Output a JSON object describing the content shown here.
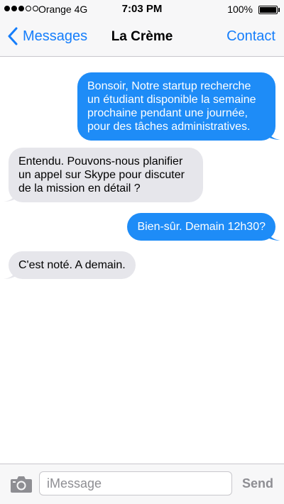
{
  "status_bar": {
    "carrier": "Orange 4G",
    "time": "7:03 PM",
    "battery": "100%",
    "signal_strength": 3,
    "signal_max": 5
  },
  "nav": {
    "back_label": "Messages",
    "title": "La Crème",
    "contact_label": "Contact"
  },
  "messages": [
    {
      "direction": "outgoing",
      "text": "Bonsoir, Notre startup recherche\nun étudiant disponible la semaine\nprochaine pendant une journée,\npour des tâches administratives."
    },
    {
      "direction": "incoming",
      "text": "Entendu. Pouvons-nous planifier\nun appel sur Skype pour discuter\nde la mission en détail ?"
    },
    {
      "direction": "outgoing",
      "text": "Bien-sûr. Demain 12h30?"
    },
    {
      "direction": "incoming",
      "text": "C'est noté. A demain."
    }
  ],
  "input": {
    "placeholder": "iMessage",
    "send_label": "Send"
  },
  "colors": {
    "accent": "#157efb",
    "outgoing_bubble": "#1e8cf7",
    "incoming_bubble": "#e6e6eb"
  }
}
